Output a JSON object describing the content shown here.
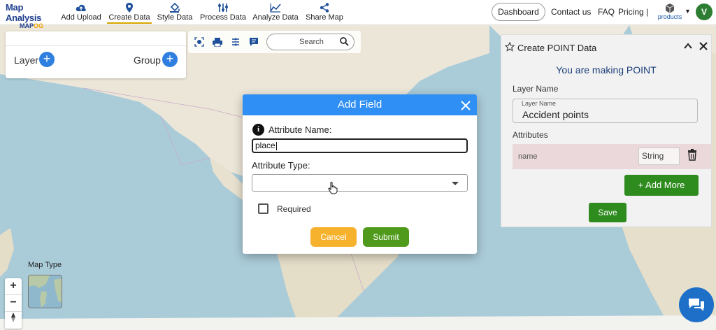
{
  "logo": {
    "line1": "Map Analysis",
    "line2a": "MAP",
    "line2b": "OG"
  },
  "nav": [
    {
      "label": "Add Upload",
      "icon": "cloud-upload-icon"
    },
    {
      "label": "Create Data",
      "icon": "map-pin-icon",
      "active": true
    },
    {
      "label": "Style Data",
      "icon": "paint-bucket-icon"
    },
    {
      "label": "Process Data",
      "icon": "process-icon"
    },
    {
      "label": "Analyze Data",
      "icon": "analyze-icon"
    },
    {
      "label": "Share Map",
      "icon": "share-icon"
    }
  ],
  "topright": {
    "dashboard": "Dashboard",
    "contact": "Contact us",
    "faq": "FAQ",
    "pricing": "Pricing |",
    "products": "products",
    "avatar": "V"
  },
  "layerpanel": {
    "layer": "Layer",
    "group": "Group"
  },
  "search": {
    "placeholder": "Search"
  },
  "rightpanel": {
    "title": "Create POINT Data",
    "making": "You are making POINT",
    "layer_name_label": "Layer Name",
    "layer_name_float": "Layer Name",
    "layer_name_value": "Accident points",
    "attributes_label": "Attributes",
    "attr_name": "name",
    "attr_type": "String",
    "add_more": "+ Add More",
    "save": "Save"
  },
  "maptype": {
    "label": "Map Type"
  },
  "modal": {
    "title": "Add Field",
    "attr_name_label": "Attribute Name:",
    "attr_name_value": "place",
    "attr_type_label": "Attribute Type:",
    "required_label": "Required",
    "cancel": "Cancel",
    "submit": "Submit"
  },
  "colors": {
    "accent_blue": "#2f8ff5",
    "green": "#2e8b1e",
    "cancel_orange": "#f6b22d",
    "sea": "#aacbd8",
    "land": "#ece6d8"
  }
}
